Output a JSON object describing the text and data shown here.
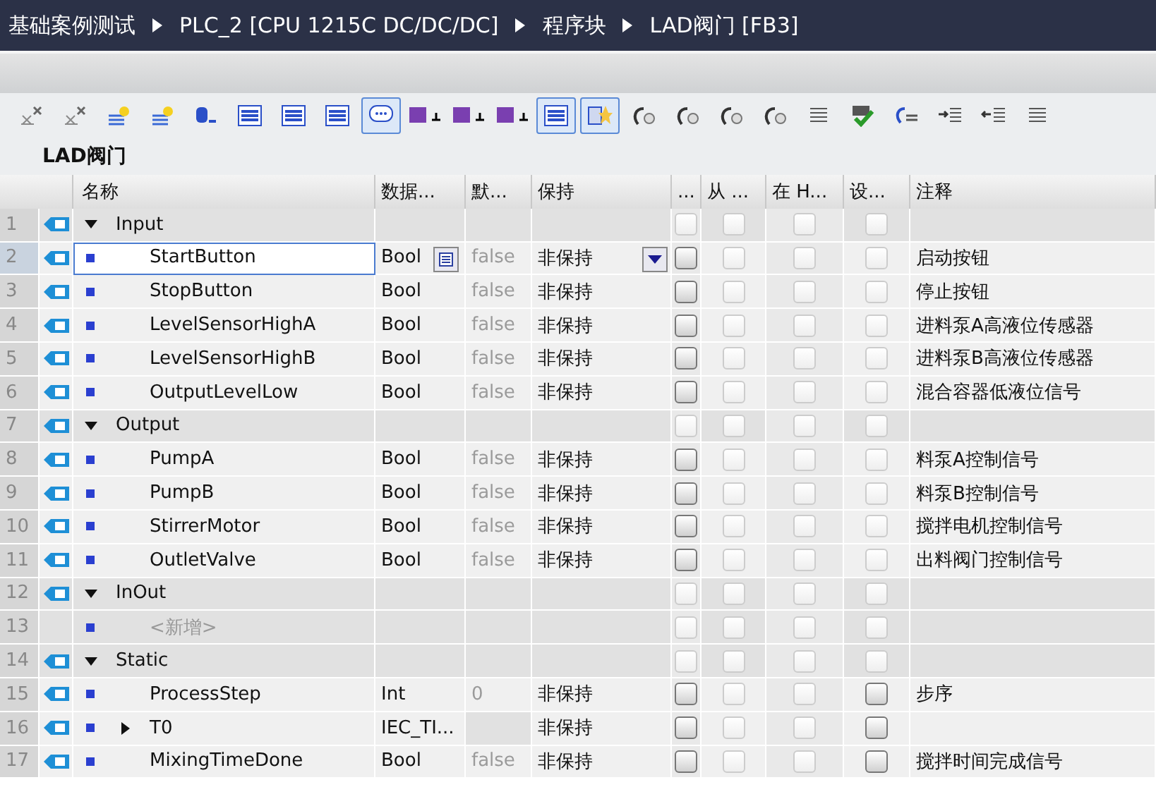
{
  "breadcrumb": [
    "基础案例测试",
    "PLC_2 [CPU 1215C DC/DC/DC]",
    "程序块",
    "LAD阀门 [FB3]"
  ],
  "toolbar": [
    {
      "pressed": false
    },
    {
      "pressed": false
    },
    {
      "pressed": false
    },
    {
      "pressed": false
    },
    {
      "pressed": false
    },
    {
      "pressed": false
    },
    {
      "pressed": false
    },
    {
      "pressed": false
    },
    {
      "pressed": true
    },
    {
      "pressed": false
    },
    {
      "pressed": false
    },
    {
      "pressed": false
    },
    {
      "pressed": true
    },
    {
      "pressed": true
    },
    {
      "pressed": false
    },
    {
      "pressed": false
    },
    {
      "pressed": false
    },
    {
      "pressed": false
    },
    {
      "pressed": false
    },
    {
      "pressed": false
    },
    {
      "pressed": false
    },
    {
      "pressed": false
    },
    {
      "pressed": false
    },
    {
      "pressed": false
    }
  ],
  "block_title": "LAD阀门",
  "table": {
    "columns": [
      "名称",
      "数据...",
      "默...",
      "保持",
      "...",
      "从 ...",
      "在 H...",
      "设...",
      "注释"
    ],
    "rows": [
      {
        "no": "1",
        "kind": "section",
        "name": "Input",
        "expanded": true,
        "checks": [
          {
            "disabled": true
          },
          {
            "disabled": true
          },
          {
            "disabled": true
          },
          {
            "disabled": true
          }
        ]
      },
      {
        "no": "2",
        "kind": "member",
        "name": "StartButton",
        "type": "Bool",
        "default": "false",
        "retain": "非保持",
        "comment": "启动按钮",
        "selected": true,
        "checks": [
          {
            "disabled": false
          },
          {
            "disabled": true
          },
          {
            "disabled": true
          },
          {
            "disabled": true
          }
        ]
      },
      {
        "no": "3",
        "kind": "member",
        "name": "StopButton",
        "type": "Bool",
        "default": "false",
        "retain": "非保持",
        "comment": "停止按钮",
        "selected": false,
        "checks": [
          {
            "disabled": false
          },
          {
            "disabled": true
          },
          {
            "disabled": true
          },
          {
            "disabled": true
          }
        ]
      },
      {
        "no": "4",
        "kind": "member",
        "name": "LevelSensorHighA",
        "type": "Bool",
        "default": "false",
        "retain": "非保持",
        "comment": "进料泵A高液位传感器",
        "selected": false,
        "checks": [
          {
            "disabled": false
          },
          {
            "disabled": true
          },
          {
            "disabled": true
          },
          {
            "disabled": true
          }
        ]
      },
      {
        "no": "5",
        "kind": "member",
        "name": "LevelSensorHighB",
        "type": "Bool",
        "default": "false",
        "retain": "非保持",
        "comment": "进料泵B高液位传感器",
        "selected": false,
        "checks": [
          {
            "disabled": false
          },
          {
            "disabled": true
          },
          {
            "disabled": true
          },
          {
            "disabled": true
          }
        ]
      },
      {
        "no": "6",
        "kind": "member",
        "name": "OutputLevelLow",
        "type": "Bool",
        "default": "false",
        "retain": "非保持",
        "comment": "混合容器低液位信号",
        "selected": false,
        "checks": [
          {
            "disabled": false
          },
          {
            "disabled": true
          },
          {
            "disabled": true
          },
          {
            "disabled": true
          }
        ]
      },
      {
        "no": "7",
        "kind": "section",
        "name": "Output",
        "expanded": true,
        "checks": [
          {
            "disabled": true
          },
          {
            "disabled": true
          },
          {
            "disabled": true
          },
          {
            "disabled": true
          }
        ]
      },
      {
        "no": "8",
        "kind": "member",
        "name": "PumpA",
        "type": "Bool",
        "default": "false",
        "retain": "非保持",
        "comment": "料泵A控制信号",
        "selected": false,
        "checks": [
          {
            "disabled": false
          },
          {
            "disabled": true
          },
          {
            "disabled": true
          },
          {
            "disabled": true
          }
        ]
      },
      {
        "no": "9",
        "kind": "member",
        "name": "PumpB",
        "type": "Bool",
        "default": "false",
        "retain": "非保持",
        "comment": "料泵B控制信号",
        "selected": false,
        "checks": [
          {
            "disabled": false
          },
          {
            "disabled": true
          },
          {
            "disabled": true
          },
          {
            "disabled": true
          }
        ]
      },
      {
        "no": "10",
        "kind": "member",
        "name": "StirrerMotor",
        "type": "Bool",
        "default": "false",
        "retain": "非保持",
        "comment": "搅拌电机控制信号",
        "selected": false,
        "checks": [
          {
            "disabled": false
          },
          {
            "disabled": true
          },
          {
            "disabled": true
          },
          {
            "disabled": true
          }
        ]
      },
      {
        "no": "11",
        "kind": "member",
        "name": "OutletValve",
        "type": "Bool",
        "default": "false",
        "retain": "非保持",
        "comment": "出料阀门控制信号",
        "selected": false,
        "checks": [
          {
            "disabled": false
          },
          {
            "disabled": true
          },
          {
            "disabled": true
          },
          {
            "disabled": true
          }
        ]
      },
      {
        "no": "12",
        "kind": "section",
        "name": "InOut",
        "expanded": true,
        "checks": [
          {
            "disabled": true
          },
          {
            "disabled": true
          },
          {
            "disabled": true
          },
          {
            "disabled": true
          }
        ]
      },
      {
        "no": "13",
        "kind": "placeholder",
        "name": "<新增>",
        "checks": [
          {
            "disabled": true
          },
          {
            "disabled": true
          },
          {
            "disabled": true
          },
          {
            "disabled": true
          }
        ]
      },
      {
        "no": "14",
        "kind": "section",
        "name": "Static",
        "expanded": true,
        "checks": [
          {
            "disabled": true
          },
          {
            "disabled": true
          },
          {
            "disabled": true
          },
          {
            "disabled": true
          }
        ]
      },
      {
        "no": "15",
        "kind": "member",
        "name": "ProcessStep",
        "type": "Int",
        "default": "0",
        "retain": "非保持",
        "comment": "步序",
        "selected": false,
        "checks": [
          {
            "disabled": false
          },
          {
            "disabled": true
          },
          {
            "disabled": true
          },
          {
            "disabled": false
          }
        ]
      },
      {
        "no": "16",
        "kind": "member",
        "name": "T0",
        "expanded": false,
        "type": "IEC_TI...",
        "retain": "非保持",
        "selected": false,
        "checks": [
          {
            "disabled": false
          },
          {
            "disabled": true
          },
          {
            "disabled": true
          },
          {
            "disabled": false
          }
        ]
      },
      {
        "no": "17",
        "kind": "member",
        "name": "MixingTimeDone",
        "type": "Bool",
        "default": "false",
        "retain": "非保持",
        "comment": "搅拌时间完成信号",
        "selected": false,
        "checks": [
          {
            "disabled": false
          },
          {
            "disabled": true
          },
          {
            "disabled": true
          },
          {
            "disabled": false
          }
        ]
      }
    ]
  }
}
